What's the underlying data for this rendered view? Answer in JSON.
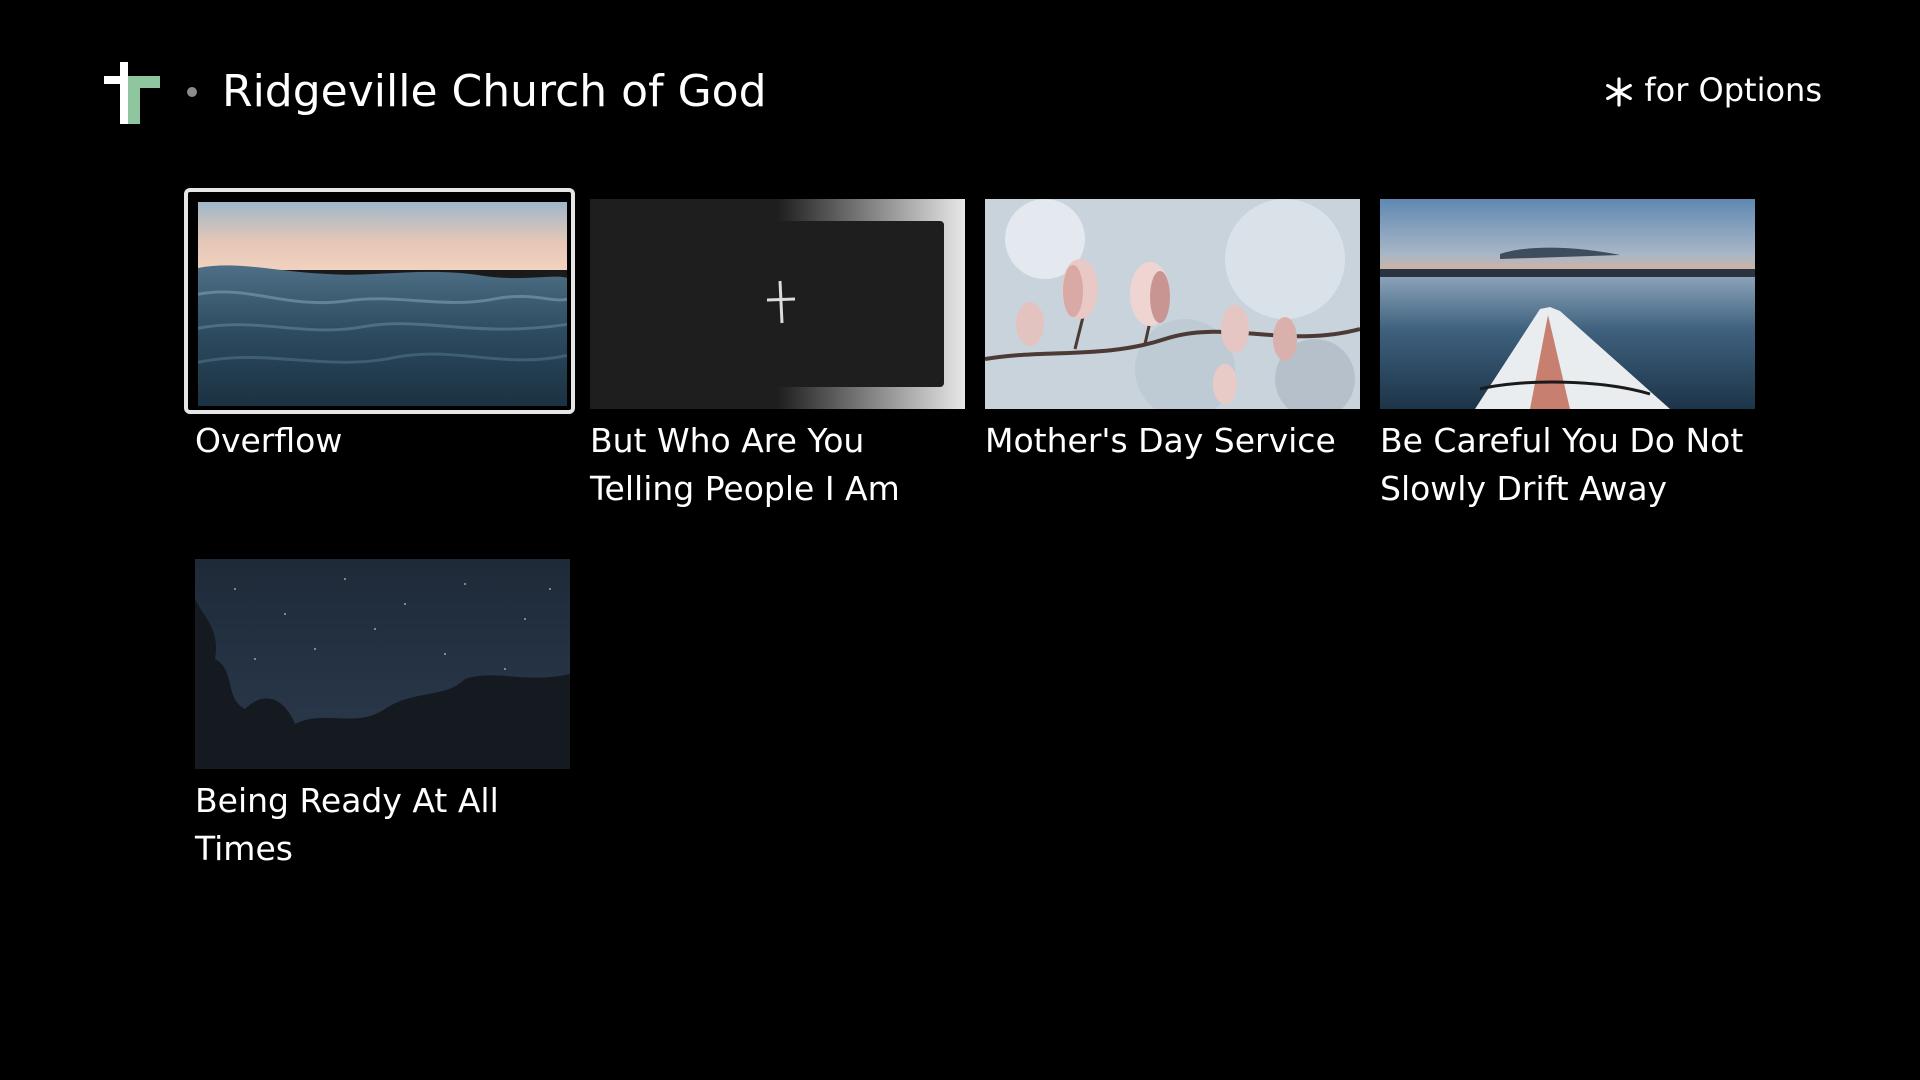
{
  "header": {
    "channel_title": "Ridgeville Church of God",
    "options_label": "for Options",
    "options_icon": "asterisk-icon",
    "logo_icon": "cross-logo-icon",
    "logo_color_light": "#ffffff",
    "logo_color_accent": "#8fc6a0"
  },
  "grid": {
    "focused_index": 0,
    "items": [
      {
        "title": "Overflow",
        "thumbnail": "ocean-waves-image"
      },
      {
        "title": "But Who Are You Telling People I Am",
        "thumbnail": "cross-on-dark-image"
      },
      {
        "title": "Mother's Day Service",
        "thumbnail": "magnolia-blossoms-image"
      },
      {
        "title": "Be Careful You Do Not Slowly Drift Away",
        "thumbnail": "kayak-on-lake-image"
      },
      {
        "title": "Being Ready At All Times",
        "thumbnail": "night-sky-trees-image"
      }
    ]
  },
  "colors": {
    "background": "#000000",
    "text": "#ffffff",
    "focus_ring": "#e6e6e6"
  }
}
